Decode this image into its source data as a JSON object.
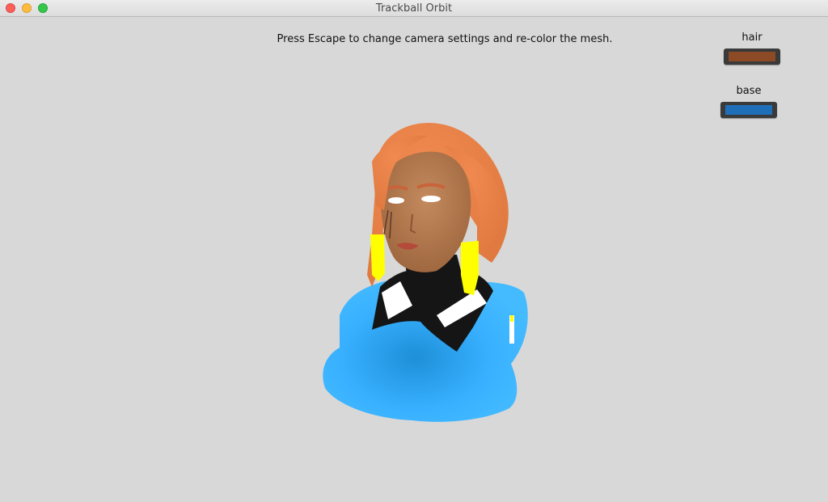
{
  "window": {
    "title": "Trackball Orbit"
  },
  "instruction": "Press Escape to change camera settings and re-color the mesh.",
  "swatches": {
    "hair": {
      "label": "hair",
      "color": "#8c4a26"
    },
    "base": {
      "label": "base",
      "color": "#1f6fb8"
    }
  },
  "model": {
    "icon": "3d-character-bust",
    "colors": {
      "hair": "#e07a40",
      "skin": "#b87a52",
      "body": "#38b0ff",
      "suit": "#151515",
      "stripe": "#ffffff",
      "earrings": "#ffff00"
    }
  }
}
